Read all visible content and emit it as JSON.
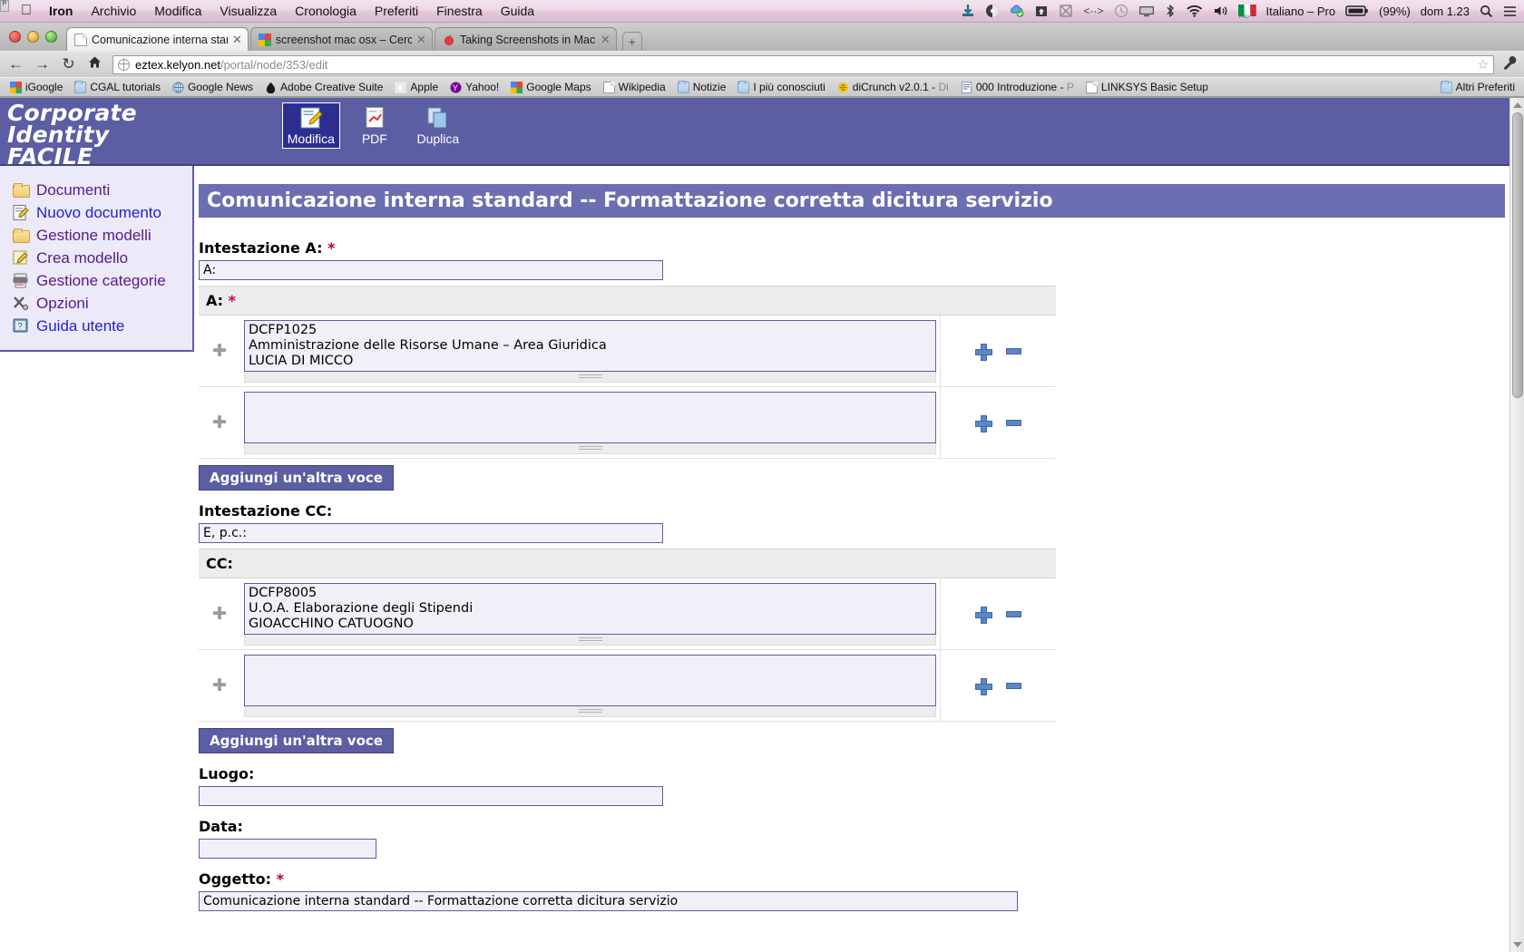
{
  "menubar": {
    "apple": "apple-logo",
    "items": [
      "Iron",
      "Archivio",
      "Modifica",
      "Visualizza",
      "Cronologia",
      "Preferiti",
      "Finestra",
      "Guida"
    ],
    "status_icons": [
      "download-icon",
      "dropbox-icon",
      "cloud-sync-icon",
      "upload-folder-icon",
      "crossed-box-icon",
      "code-brackets-icon",
      "clock-icon",
      "display-icon",
      "bluetooth-icon",
      "wifi-icon",
      "volume-icon"
    ],
    "flag": "italian-flag-icon",
    "input_source": "Italiano – Pro",
    "battery_icon": "battery-icon",
    "battery": "(99%)",
    "clock": "dom 1.23",
    "spotlight": "search-icon",
    "menu_extras": "menu-icon"
  },
  "browser": {
    "tabs": [
      {
        "label": "Comunicazione interna stand",
        "favicon": "document-favicon",
        "active": true,
        "close": "✕"
      },
      {
        "label": "screenshot mac osx – Cerca",
        "favicon": "google-favicon",
        "active": false,
        "close": "✕"
      },
      {
        "label": "Taking Screenshots in Mac O",
        "favicon": "apple-favicon",
        "active": false,
        "close": "✕"
      }
    ],
    "new_tab_label": "+",
    "nav": {
      "back": "←",
      "forward": "→",
      "reload": "↻",
      "home": "⌂"
    },
    "url_prefix": "eztex.kelyon.net",
    "url_path": "/portal/node/353/edit",
    "bookmark_star": "☆",
    "menu_button": "wrench-icon",
    "bookmarks": [
      {
        "label": "iGoogle",
        "icon": "google-icon",
        "dim": ""
      },
      {
        "label": "CGAL tutorials",
        "icon": "folder-icon",
        "dim": ""
      },
      {
        "label": "Google News",
        "icon": "globe-icon",
        "dim": ""
      },
      {
        "label": "Adobe Creative Suite",
        "icon": "adobe-icon",
        "dim": ""
      },
      {
        "label": "Apple",
        "icon": "apple-icon",
        "dim": ""
      },
      {
        "label": "Yahoo!",
        "icon": "yahoo-icon",
        "dim": ""
      },
      {
        "label": "Google Maps",
        "icon": "google-icon",
        "dim": ""
      },
      {
        "label": "Wikipedia",
        "icon": "page-icon",
        "dim": ""
      },
      {
        "label": "Notizie",
        "icon": "folder-icon",
        "dim": ""
      },
      {
        "label": "I più conosciuti",
        "icon": "folder-icon",
        "dim": ""
      },
      {
        "label": "diCrunch v2.0.1 - ",
        "icon": "dicrunch-icon",
        "dim": "Di"
      },
      {
        "label": "000 Introduzione - ",
        "icon": "pdf-icon",
        "dim": "P"
      },
      {
        "label": "LINKSYS Basic Setup",
        "icon": "page-icon",
        "dim": ""
      }
    ],
    "other_bookmarks": {
      "label": "Altri Preferiti",
      "icon": "folder-icon"
    }
  },
  "site": {
    "logo_lines": [
      "Corporate",
      "Identity",
      "FACILE"
    ],
    "toolbuttons": [
      {
        "label": "Modifica",
        "icon": "edit-pencil-icon",
        "selected": true
      },
      {
        "label": "PDF",
        "icon": "pdf-icon",
        "selected": false
      },
      {
        "label": "Duplica",
        "icon": "duplicate-icon",
        "selected": false
      }
    ],
    "sidebar": [
      {
        "label": "Documenti",
        "icon": "folder-icon"
      },
      {
        "label": "Nuovo documento",
        "icon": "new-document-icon"
      },
      {
        "label": "Gestione modelli",
        "icon": "folder-icon"
      },
      {
        "label": "Crea modello",
        "icon": "edit-template-icon"
      },
      {
        "label": "Gestione categorie",
        "icon": "printer-icon"
      },
      {
        "label": "Opzioni",
        "icon": "tools-icon"
      },
      {
        "label": "Guida utente",
        "icon": "help-book-icon"
      }
    ]
  },
  "main": {
    "page_title": "Comunicazione interna standard -- Formattazione corretta dicitura servizio",
    "fields": {
      "intestazione_a": {
        "label": "Intestazione A:",
        "required": "*",
        "value": "A:"
      },
      "a_table": {
        "label": "A:",
        "required": "*",
        "rows": [
          {
            "drag": "drag-handle-icon",
            "value": "DCFP1025\nAmministrazione delle Risorse Umane – Area Giuridica\nLUCIA DI MICCO",
            "add": "plus-icon",
            "remove": "minus-icon"
          },
          {
            "drag": "drag-handle-icon",
            "value": "",
            "add": "plus-icon",
            "remove": "minus-icon"
          }
        ],
        "add_button": "Aggiungi un'altra voce"
      },
      "intestazione_cc": {
        "label": "Intestazione CC:",
        "required": "",
        "value": "E, p.c.:"
      },
      "cc_table": {
        "label": "CC:",
        "required": "",
        "rows": [
          {
            "drag": "drag-handle-icon",
            "value": "DCFP8005\nU.O.A. Elaborazione degli Stipendi\nGIOACCHINO CATUOGNO",
            "add": "plus-icon",
            "remove": "minus-icon"
          },
          {
            "drag": "drag-handle-icon",
            "value": "",
            "add": "plus-icon",
            "remove": "minus-icon"
          }
        ],
        "add_button": "Aggiungi un'altra voce"
      },
      "luogo": {
        "label": "Luogo:",
        "required": "",
        "value": ""
      },
      "data": {
        "label": "Data:",
        "required": "",
        "value": ""
      },
      "oggetto": {
        "label": "Oggetto:",
        "required": "*",
        "value": "Comunicazione interna standard -- Formattazione corretta dicitura servizio"
      }
    }
  },
  "colors": {
    "brand": "#5b5ea3",
    "title_bar": "#6b6eb0",
    "sidebar_bg": "#eceaf8",
    "input_bg": "#f1f0f9",
    "required": "#c00030",
    "link": "#551a8b"
  }
}
